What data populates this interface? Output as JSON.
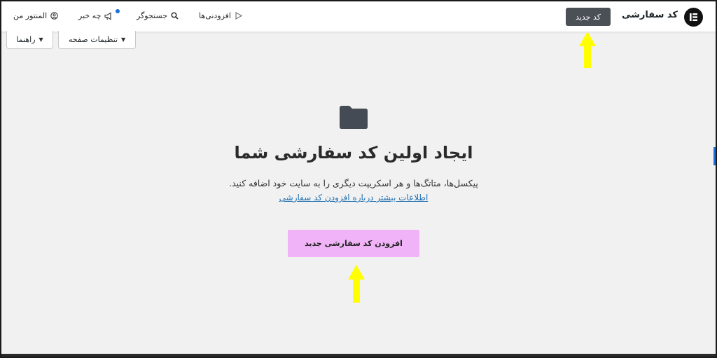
{
  "topbar": {
    "page_title": "کد سفارشی",
    "new_button": "کد جدید",
    "nav": {
      "addons": "افزودنی‌ها",
      "search": "جستجوگر",
      "whats_new": "چه خبر",
      "my_elementor": "المنتور من"
    }
  },
  "subbar": {
    "page_settings": "تنظیمات صفحه",
    "help": "راهنما"
  },
  "empty_state": {
    "icon": "folder-icon",
    "title": "ایجاد اولین کد سفارشی شما",
    "description": "پیکسل‌ها، متاتگ‌ها و هر اسکریپت دیگری را به سایت خود اضافه کنید.",
    "learn_more": "اطلاعات بیشتر درباره افزودن کد سفارشی",
    "cta": "افزودن کد سفارشی جدید"
  },
  "colors": {
    "accent_dark": "#4b4f56",
    "cta_pink": "#f0b3f7",
    "link_blue": "#2271b1",
    "annotation_yellow": "#ffff00"
  }
}
